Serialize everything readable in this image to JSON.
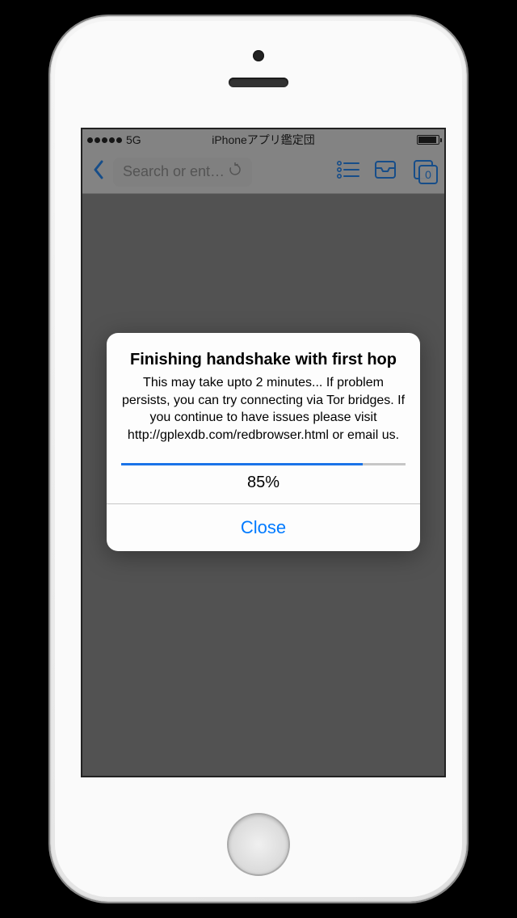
{
  "status_bar": {
    "carrier": "5G",
    "title": "iPhoneアプリ鑑定団"
  },
  "nav": {
    "search_placeholder": "Search or ent…",
    "tab_count": "0"
  },
  "alert": {
    "title": "Finishing handshake with first hop",
    "message": "This may take upto 2 minutes... If problem persists, you can try connecting via Tor bridges.  If you continue to have issues please visit http://gplexdb.com/redbrowser.html or email us.",
    "progress_percent": 85,
    "progress_label": "85%",
    "close_label": "Close"
  }
}
